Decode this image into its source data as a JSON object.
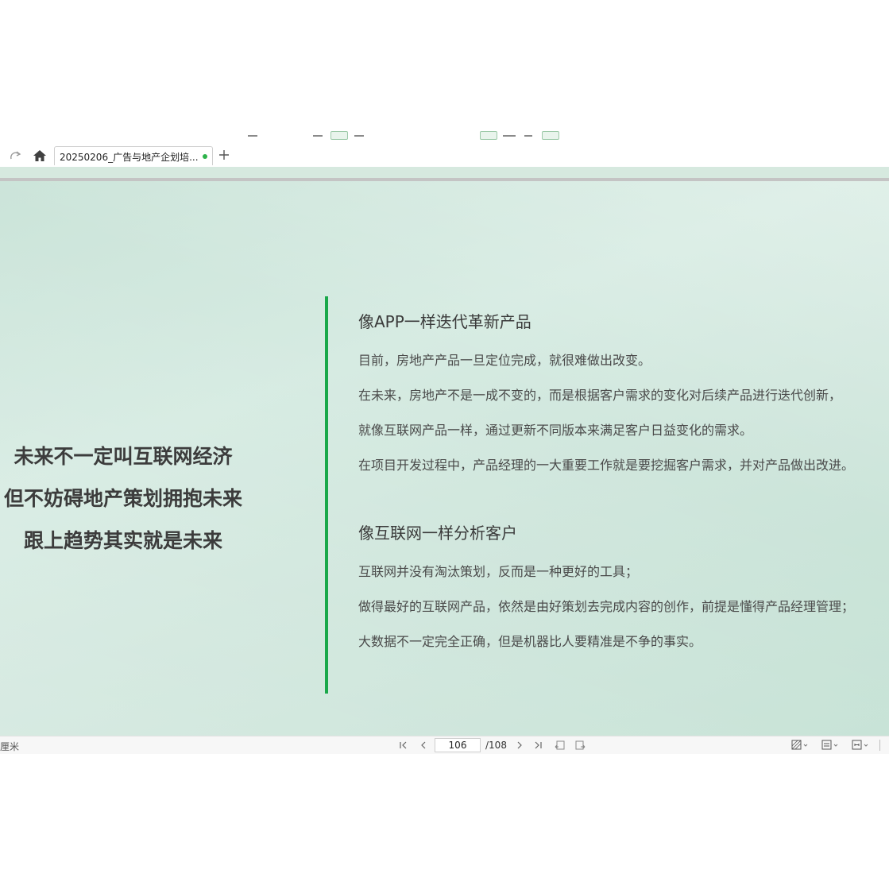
{
  "tab": {
    "title": "20250206_广告与地产企划培..."
  },
  "slide": {
    "slogan": [
      "未来不一定叫互联网经济",
      "但不妨碍地产策划拥抱未来",
      "跟上趋势其实就是未来"
    ],
    "accent_color": "#1aa84a",
    "sections": [
      {
        "heading": "像APP一样迭代革新产品",
        "paragraphs": [
          "目前，房地产产品一旦定位完成，就很难做出改变。",
          "在未来，房地产不是一成不变的，而是根据客户需求的变化对后续产品进行迭代创新，",
          "就像互联网产品一样，通过更新不同版本来满足客户日益变化的需求。",
          "在项目开发过程中，产品经理的一大重要工作就是要挖掘客户需求，并对产品做出改进。"
        ]
      },
      {
        "heading": "像互联网一样分析客户",
        "paragraphs": [
          "互联网并没有淘汰策划，反而是一种更好的工具；",
          "做得最好的互联网产品，依然是由好策划去完成内容的创作，前提是懂得产品经理管理；",
          "大数据不一定完全正确，但是机器比人要精准是不争的事实。"
        ]
      }
    ]
  },
  "statusbar": {
    "unit": "厘米",
    "current_page": "106",
    "total_pages": "/108"
  }
}
